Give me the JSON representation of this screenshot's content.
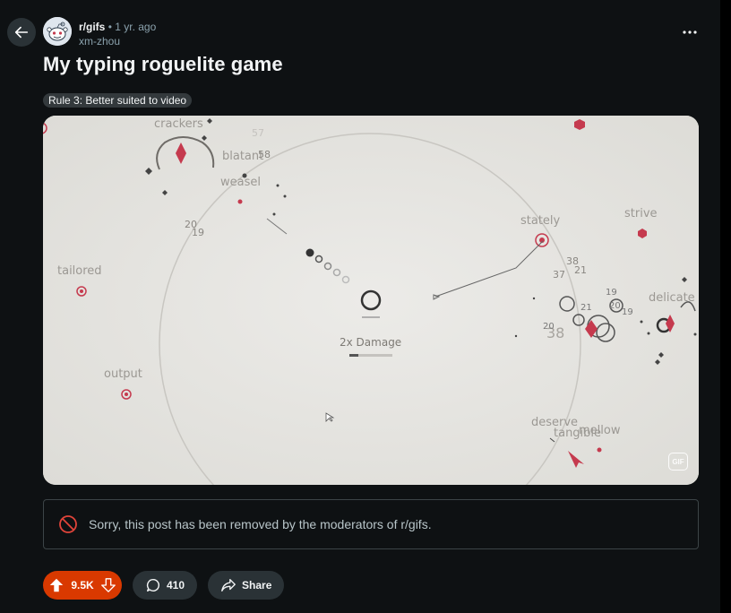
{
  "post": {
    "subreddit": "r/gifs",
    "separator": "•",
    "time": "1 yr. ago",
    "author": "xm-zhou",
    "title": "My typing roguelite game",
    "flair": "Rule 3: Better suited to video"
  },
  "media": {
    "badge": "GIF",
    "game": {
      "words": {
        "crackers": "crackers",
        "blatant": "blatant",
        "weasel": "weasel",
        "tailored": "tailored",
        "output": "output",
        "stately": "stately",
        "strive": "strive",
        "delicate": "delicate",
        "deserve": "deserve",
        "tangible": "tangible",
        "mellow": "mellow"
      },
      "damage_label": "2x Damage",
      "numbers": {
        "n57": "57",
        "n58": "58",
        "n20": "20",
        "n19": "19",
        "n38": "38",
        "n37": "37",
        "n21": "21",
        "n38b": "38"
      }
    }
  },
  "removed_notice": "Sorry, this post has been removed by the moderators of r/gifs.",
  "actions": {
    "votes": "9.5K",
    "comments": "410",
    "share": "Share"
  },
  "colors": {
    "upvote_bg": "#d93900",
    "accent_red": "#c53a4e"
  }
}
